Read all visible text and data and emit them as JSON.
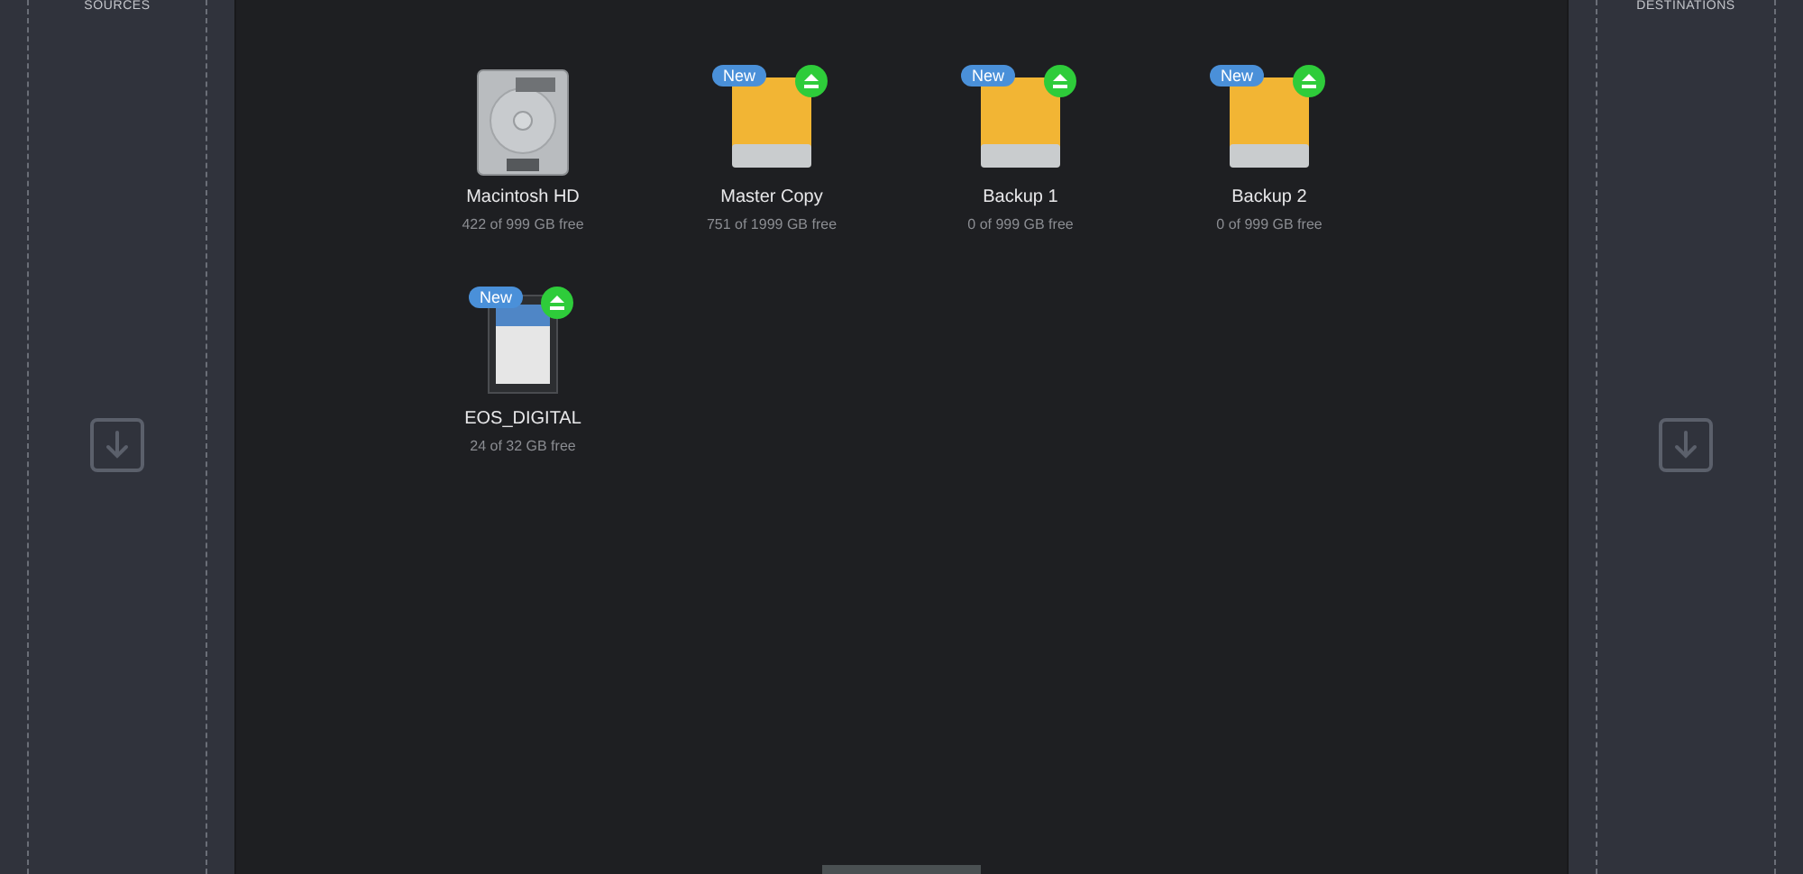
{
  "sources_panel": {
    "label": "SOURCES"
  },
  "destinations_panel": {
    "label": "DESTINATIONS"
  },
  "drives": [
    {
      "kind": "hdd",
      "name": "Macintosh HD",
      "capacity": "422 of 999 GB free",
      "new": false,
      "ejectable": false
    },
    {
      "kind": "external",
      "name": "Master Copy",
      "capacity": "751 of 1999 GB free",
      "new": true,
      "badge": "New",
      "ejectable": true
    },
    {
      "kind": "external",
      "name": "Backup 1",
      "capacity": "0 of 999 GB free",
      "new": true,
      "badge": "New",
      "ejectable": true
    },
    {
      "kind": "external",
      "name": "Backup 2",
      "capacity": "0 of 999 GB free",
      "new": true,
      "badge": "New",
      "ejectable": true
    },
    {
      "kind": "sd",
      "name": "EOS_DIGITAL",
      "capacity": "24 of 32 GB free",
      "new": true,
      "badge": "New",
      "ejectable": true
    }
  ]
}
